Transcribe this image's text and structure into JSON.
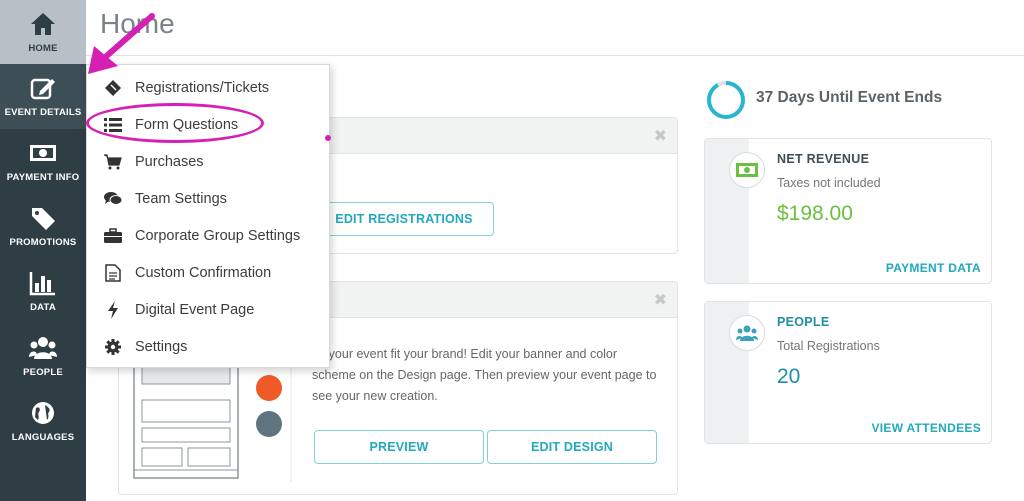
{
  "sidebar": {
    "items": [
      {
        "label": "HOME",
        "icon": "home-icon"
      },
      {
        "label": "EVENT DETAILS",
        "icon": "edit-icon"
      },
      {
        "label": "PAYMENT INFO",
        "icon": "money-icon"
      },
      {
        "label": "PROMOTIONS",
        "icon": "tag-icon"
      },
      {
        "label": "DATA",
        "icon": "bar-chart-icon"
      },
      {
        "label": "PEOPLE",
        "icon": "people-icon"
      },
      {
        "label": "LANGUAGES",
        "icon": "globe-icon"
      }
    ]
  },
  "header": {
    "title": "Home"
  },
  "menu": {
    "items": [
      {
        "label": "Registrations/Tickets",
        "icon": "ticket-icon"
      },
      {
        "label": "Form Questions",
        "icon": "list-icon"
      },
      {
        "label": "Purchases",
        "icon": "cart-icon"
      },
      {
        "label": "Team Settings",
        "icon": "comments-icon"
      },
      {
        "label": "Corporate Group Settings",
        "icon": "briefcase-icon"
      },
      {
        "label": "Custom Confirmation",
        "icon": "document-icon"
      },
      {
        "label": "Digital Event Page",
        "icon": "bolt-icon"
      },
      {
        "label": "Settings",
        "icon": "gear-icon"
      }
    ]
  },
  "registration_card": {
    "close": "✖",
    "button": "EDIT REGISTRATIONS"
  },
  "design_card": {
    "close": "✖",
    "description": "ke your event fit your brand! Edit your banner and color scheme on the Design page. Then preview your event page to see your new creation.",
    "preview_button": "PREVIEW",
    "edit_button": "EDIT DESIGN",
    "swatches": [
      "#f05a28",
      "#5e7580"
    ]
  },
  "countdown": {
    "text": "37 Days Until Event Ends",
    "progress": 0.92
  },
  "revenue": {
    "title": "NET REVENUE",
    "subtitle": "Taxes not included",
    "value": "$198.00",
    "link": "PAYMENT DATA"
  },
  "people": {
    "title": "PEOPLE",
    "subtitle": "Total Registrations",
    "value": "20",
    "link": "VIEW ATTENDEES"
  },
  "colors": {
    "sidebar": "#2f3d45",
    "accent": "#22a8bf",
    "revenue_green": "#6cbf3f",
    "highlight": "#d61fb3"
  }
}
